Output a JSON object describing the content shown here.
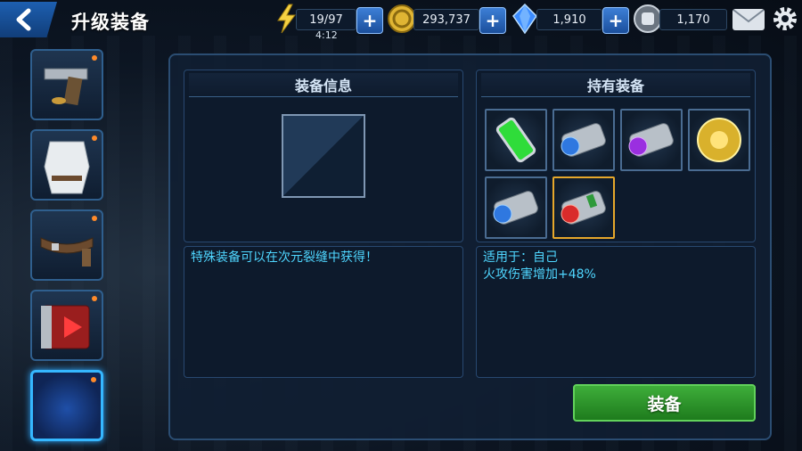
{
  "header": {
    "title": "升级装备"
  },
  "resources": {
    "energy": {
      "value": "19/97",
      "timer": "4:12",
      "icon": "lightning-icon"
    },
    "gold": {
      "value": "293,737",
      "icon": "gold-coin-icon"
    },
    "crystals": {
      "value": "1,910",
      "icon": "blue-crystal-icon"
    },
    "tokens": {
      "value": "1,170",
      "icon": "fist-token-icon"
    }
  },
  "sidebar": {
    "tabs": [
      {
        "icon": "pistol-icon",
        "has_notice": true
      },
      {
        "icon": "armor-suit-icon",
        "has_notice": true
      },
      {
        "icon": "belt-icon",
        "has_notice": true
      },
      {
        "icon": "red-device-icon",
        "has_notice": true
      },
      {
        "icon": "empty-slot-icon",
        "has_notice": true,
        "active": true
      }
    ]
  },
  "equip_info": {
    "title": "装备信息",
    "hint": "特殊装备可以在次元裂缝中获得！"
  },
  "owned": {
    "title": "持有装备",
    "items": [
      {
        "icon": "green-capsule-icon"
      },
      {
        "icon": "blue-capsule-icon"
      },
      {
        "icon": "purple-capsule-icon"
      },
      {
        "icon": "gold-orb-icon"
      },
      {
        "icon": "blue-capsule-icon"
      },
      {
        "icon": "red-capsule-icon",
        "selected": true
      }
    ],
    "applies_to": "适用于：自己",
    "effect": "火攻伤害增加+48%"
  },
  "actions": {
    "equip_label": "装备"
  },
  "colors": {
    "accent_blue": "#35b7ff",
    "equip_green": "#3eae3a",
    "text_cyan": "#4fd6ff",
    "selected_border": "#e6a72b"
  }
}
